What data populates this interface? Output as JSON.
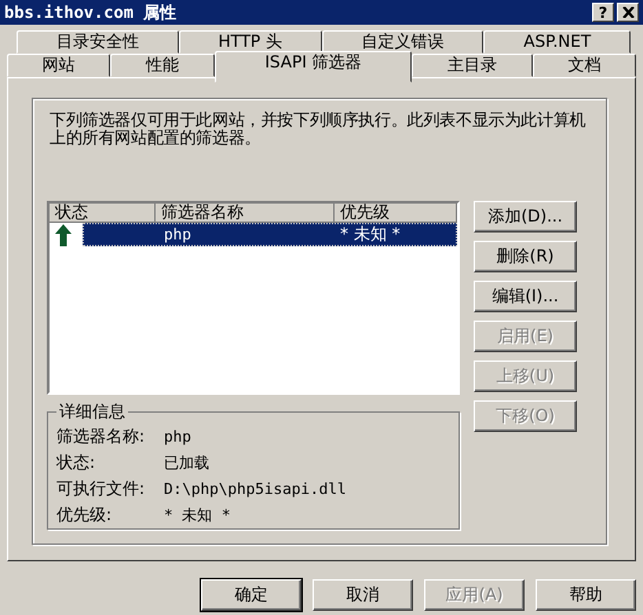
{
  "window": {
    "title": "bbs.ithov.com 属性",
    "help_button": "?"
  },
  "tabs": [
    [
      {
        "label": "目录安全性",
        "selected": false
      },
      {
        "label": "HTTP 头",
        "selected": false
      },
      {
        "label": "自定义错误",
        "selected": false
      },
      {
        "label": "ASP.NET",
        "selected": false
      }
    ],
    [
      {
        "label": "网站",
        "selected": false
      },
      {
        "label": "性能",
        "selected": false
      },
      {
        "label": "ISAPI 筛选器",
        "selected": true
      },
      {
        "label": "主目录",
        "selected": false
      },
      {
        "label": "文档",
        "selected": false
      }
    ]
  ],
  "description": "下列筛选器仅可用于此网站，并按下列顺序执行。此列表不显示为此计算机上的所有网站配置的筛选器。",
  "filters": {
    "columns": [
      "状态",
      "筛选器名称",
      "优先级"
    ],
    "rows": [
      {
        "kind": "loaded",
        "name": "php",
        "priority": "* 未知 *",
        "selected": true
      }
    ]
  },
  "side_buttons": [
    {
      "label": "添加(D)...",
      "disabled": false
    },
    {
      "label": "删除(R)",
      "disabled": false
    },
    {
      "label": "编辑(I)...",
      "disabled": false
    },
    {
      "label": "启用(E)",
      "disabled": true
    },
    {
      "label": "上移(U)",
      "disabled": true
    },
    {
      "label": "下移(O)",
      "disabled": true
    }
  ],
  "details": {
    "title": "详细信息",
    "fields": [
      {
        "label": "筛选器名称:",
        "value": "php"
      },
      {
        "label": "状态:",
        "value": "已加载"
      },
      {
        "label": "可执行文件:",
        "value": "D:\\php\\php5isapi.dll"
      },
      {
        "label": "优先级:",
        "value": "* 未知 *"
      }
    ]
  },
  "buttons": [
    {
      "label": "确定",
      "disabled": false,
      "default": true
    },
    {
      "label": "取消",
      "disabled": false,
      "default": false
    },
    {
      "label": "应用(A)",
      "disabled": true,
      "default": false
    },
    {
      "label": "帮助",
      "disabled": false,
      "default": false
    }
  ]
}
